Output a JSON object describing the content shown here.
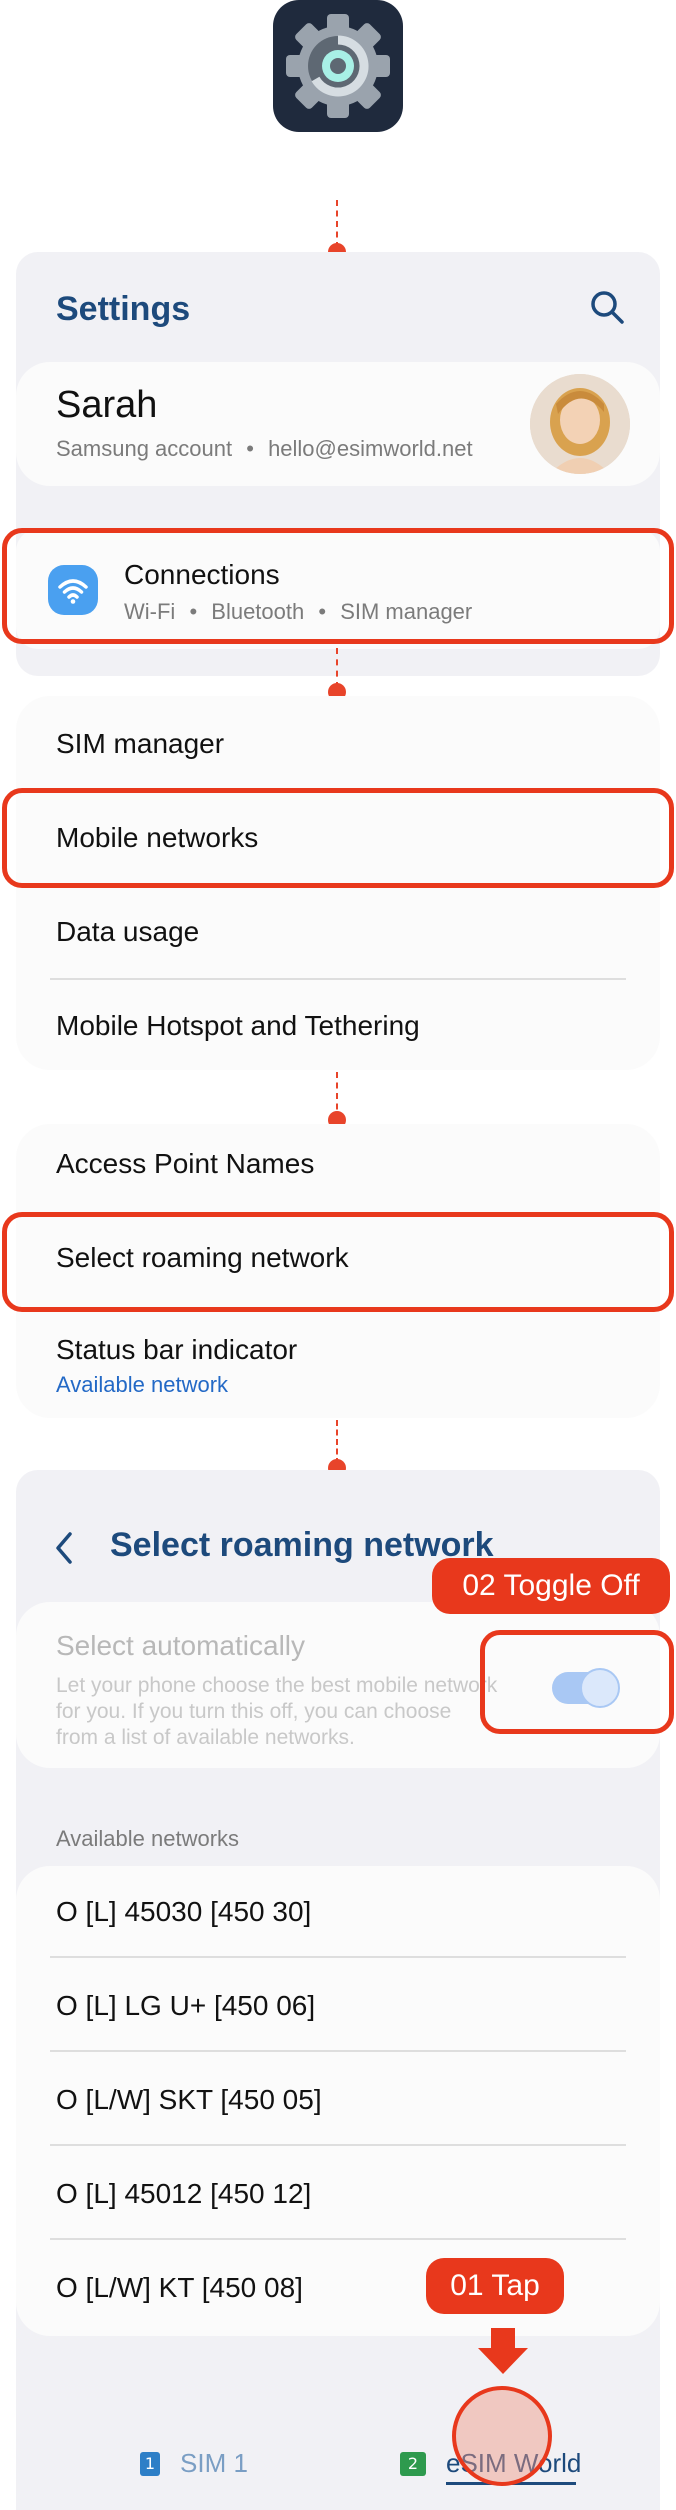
{
  "settings": {
    "title": "Settings",
    "profile": {
      "name": "Sarah",
      "account_label": "Samsung account",
      "email": "hello@esimworld.net"
    },
    "connections": {
      "title": "Connections",
      "sub_wifi": "Wi-Fi",
      "sub_bluetooth": "Bluetooth",
      "sub_sim": "SIM manager"
    },
    "separator": "•"
  },
  "connections_menu": {
    "items": [
      "SIM manager",
      "Mobile networks",
      "Data usage",
      "Mobile Hotspot and Tethering"
    ]
  },
  "mobile_networks_menu": {
    "items": [
      "Access Point Names",
      "Select roaming network",
      "Status bar indicator"
    ],
    "status_bar_sub": "Available network"
  },
  "roaming_screen": {
    "title": "Select roaming network",
    "select_auto": {
      "label": "Select automatically",
      "description_lines": [
        "Let your phone choose the best mobile network",
        "for you. If you turn this off, you can choose",
        "from a list of available networks."
      ],
      "toggle_on": true
    },
    "available_header": "Available networks",
    "networks": [
      "O [L] 45030 [450 30]",
      "O [L] LG U+ [450 06]",
      "O [L/W] SKT [450 05]",
      "O [L] 45012 [450 12]",
      "O [L/W] KT [450 08]"
    ],
    "sim_tabs": [
      {
        "badge": "1",
        "label": "SIM 1"
      },
      {
        "badge": "2",
        "label": "eSIM World"
      }
    ]
  },
  "callouts": {
    "toggle": "02 Toggle Off",
    "tap": "01 Tap"
  },
  "colors": {
    "accent_red": "#e8381c",
    "title_blue": "#1d4a7c",
    "link_blue": "#2369c6",
    "panel_bg": "#f1f1f5",
    "card_bg": "#fbfbfb"
  },
  "icons": [
    "settings-gear-icon",
    "search-icon",
    "wifi-icon",
    "back-arrow-icon",
    "down-arrow-icon",
    "avatar"
  ]
}
